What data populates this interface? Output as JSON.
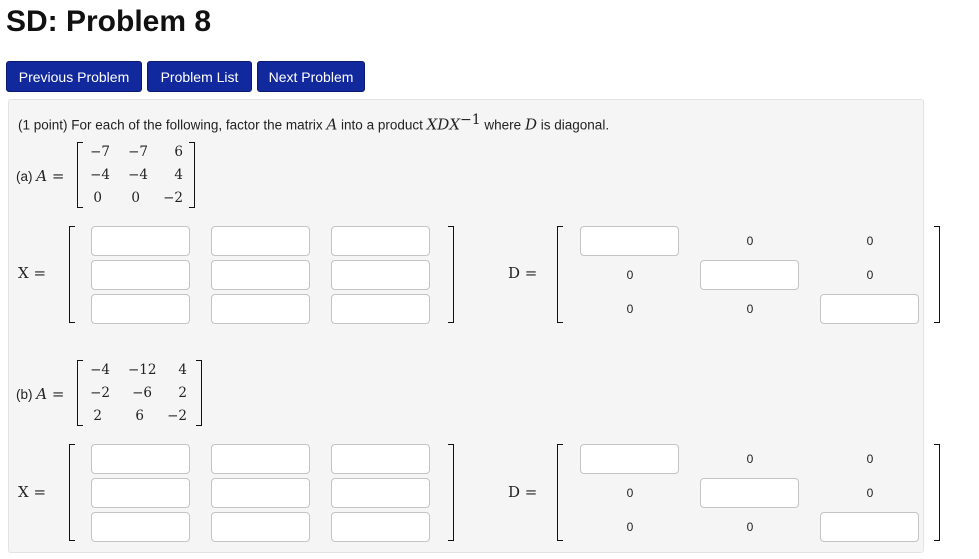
{
  "title": "SD: Problem 8",
  "nav": {
    "previous": "Previous Problem",
    "list": "Problem List",
    "next": "Next Problem"
  },
  "intro": {
    "points": "(1 point)",
    "text_before": "For each of the following, factor the matrix",
    "matrix_name": "A",
    "text_mid": "into a product",
    "product": "XDX",
    "exponent": "−1",
    "text_after": "where",
    "diag_name": "D",
    "text_end": "is diagonal."
  },
  "parts": [
    {
      "label": "(a)",
      "A": [
        [
          "−7",
          "−7",
          "6"
        ],
        [
          "−4",
          "−4",
          "4"
        ],
        [
          "0",
          "0",
          "−2"
        ]
      ],
      "x_label": "X =",
      "d_label": "D =",
      "zero": "0"
    },
    {
      "label": "(b)",
      "A": [
        [
          "−4",
          "−12",
          "4"
        ],
        [
          "−2",
          "−6",
          "2"
        ],
        [
          "2",
          "6",
          "−2"
        ]
      ],
      "x_label": "X =",
      "d_label": "D =",
      "zero": "0"
    }
  ],
  "a_symbol": "A =",
  "colors": {
    "button": "#12299e",
    "panel": "#f5f5f5"
  }
}
